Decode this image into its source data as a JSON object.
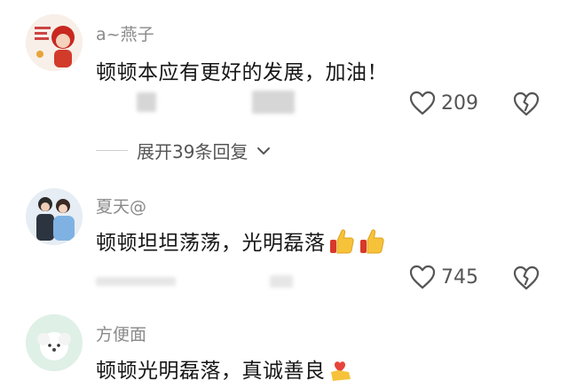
{
  "comments": [
    {
      "username": "a~燕子",
      "text": "顿顿本应有更好的发展，加油！",
      "likes": "209",
      "expand": "展开39条回复"
    },
    {
      "username": "夏天@",
      "text": "顿顿坦坦荡荡，光明磊落",
      "emojis": [
        "thumbs-up",
        "thumbs-up"
      ],
      "likes": "745"
    },
    {
      "username": "方便面",
      "text": "顿顿光明磊落，真诚善良"
    }
  ],
  "colors": {
    "username": "#8a8a8a",
    "text": "#161616",
    "icon": "#555555",
    "background": "#ffffff"
  },
  "icons": {
    "like": "heart-outline-icon",
    "dislike": "broken-heart-icon",
    "expand": "chevron-down-icon"
  }
}
